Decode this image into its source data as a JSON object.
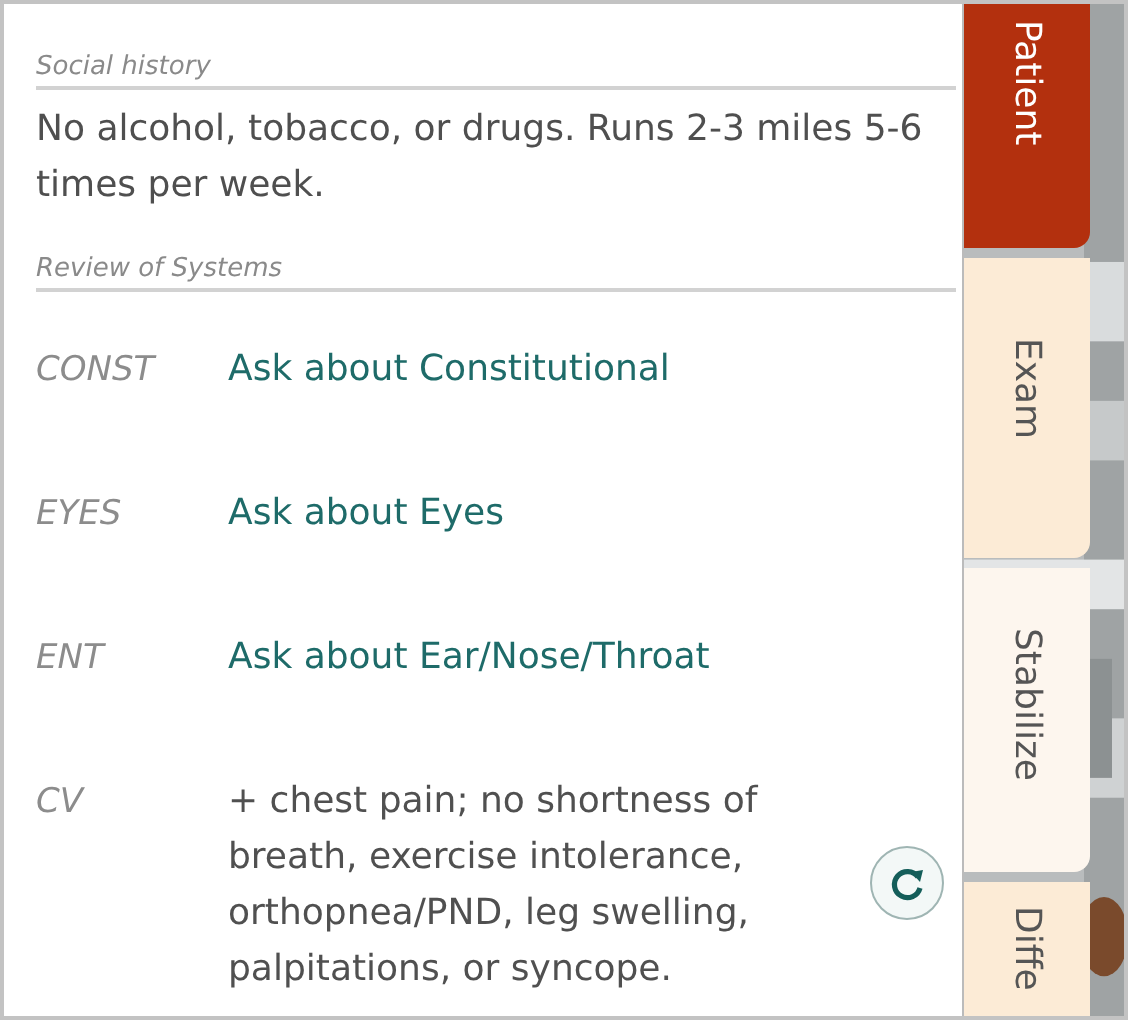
{
  "social_history": {
    "heading": "Social history",
    "text": "No alcohol, tobacco, or drugs. Runs 2-3 miles 5-6 times per week."
  },
  "review_of_systems": {
    "heading": "Review of Systems",
    "rows": [
      {
        "label": "CONST",
        "kind": "link",
        "value": "Ask about Constitutional"
      },
      {
        "label": "EYES",
        "kind": "link",
        "value": "Ask about Eyes"
      },
      {
        "label": "ENT",
        "kind": "link",
        "value": "Ask about Ear/Nose/Throat"
      },
      {
        "label": "CV",
        "kind": "text",
        "value": "+ chest pain; no shortness of breath, exercise intolerance, orthopnea/PND, leg swelling, palpitations, or syncope."
      }
    ]
  },
  "tabs": [
    {
      "label": "Patient",
      "selected": true
    },
    {
      "label": "Exam",
      "selected": false
    },
    {
      "label": "Stabilize",
      "selected": false
    },
    {
      "label": "Diffe",
      "selected": false
    }
  ]
}
